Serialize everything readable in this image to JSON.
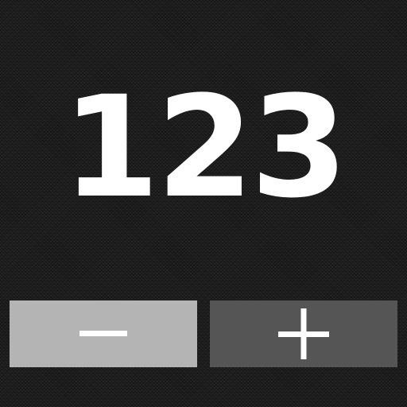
{
  "counter": {
    "value": "123"
  },
  "controls": {
    "decrement_icon": "minus-icon",
    "increment_icon": "plus-icon",
    "decrement_color": "#b4b4b4",
    "increment_color": "#555555",
    "icon_color": "#ffffff"
  },
  "background": {
    "color": "#1c1c1c"
  }
}
